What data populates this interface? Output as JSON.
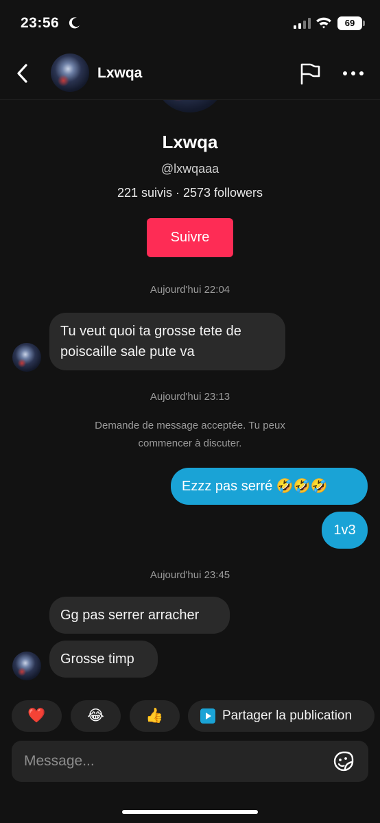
{
  "status_bar": {
    "time": "23:56",
    "battery": "69"
  },
  "header": {
    "name": "Lxwqa"
  },
  "profile": {
    "display_name": "Lxwqa",
    "handle": "@lxwqaaa",
    "stats": "221 suivis · 2573 followers",
    "follow_label": "Suivre"
  },
  "conversation": {
    "timestamp_1": "Aujourd'hui 22:04",
    "incoming_1": "Tu veut quoi ta grosse tete de poiscaille sale pute va",
    "timestamp_2": "Aujourd'hui 23:13",
    "system_message": "Demande de message acceptée. Tu peux commencer à discuter.",
    "outgoing_1": "Ezzz pas serré 🤣🤣🤣",
    "outgoing_2": "1v3",
    "timestamp_3": "Aujourd'hui 23:45",
    "incoming_2": "Gg pas serrer arracher",
    "incoming_3": "Grosse timp"
  },
  "quick_reactions": {
    "heart": "❤️",
    "laugh": "😂",
    "thumbs_up": "👍",
    "share_label": "Partager la publication"
  },
  "composer": {
    "placeholder": "Message..."
  },
  "colors": {
    "background": "#121212",
    "accent_red": "#fe2c55",
    "outgoing_bubble": "#1aa3d6",
    "incoming_bubble": "#2a2a2a"
  }
}
